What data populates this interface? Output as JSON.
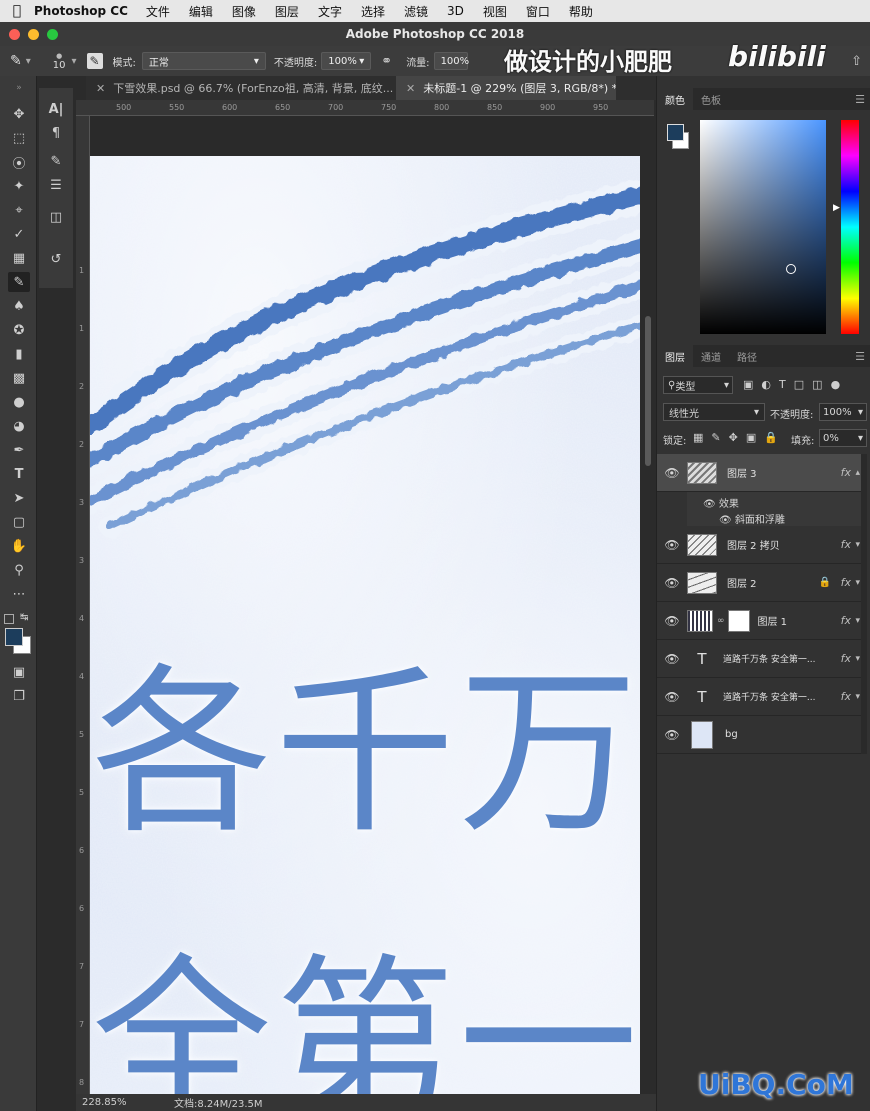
{
  "menubar": {
    "app_name": "Photoshop CC",
    "items": [
      "文件",
      "编辑",
      "图像",
      "图层",
      "文字",
      "选择",
      "滤镜",
      "3D",
      "视图",
      "窗口",
      "帮助"
    ]
  },
  "window": {
    "title": "Adobe Photoshop CC 2018"
  },
  "options": {
    "brush_size": "10",
    "mode_label": "模式:",
    "mode_value": "正常",
    "opacity_label": "不透明度:",
    "opacity_value": "100%",
    "flow_label": "流量:",
    "flow_value": "100%"
  },
  "watermark_top": "做设计的小肥肥",
  "watermark_logo": "bilibili",
  "tabs": [
    {
      "label": "下雪效果.psd @ 66.7% (ForEnzo祖, 高清, 背景, 底纹..."
    },
    {
      "label": "未标题-1 @ 229% (图层 3, RGB/8*) *"
    }
  ],
  "ruler_h": [
    "500",
    "550",
    "600",
    "650",
    "700",
    "750",
    "800",
    "850",
    "900",
    "950"
  ],
  "ruler_v": [
    "1",
    "1",
    "2",
    "2",
    "3",
    "3",
    "4",
    "4",
    "5",
    "5",
    "6",
    "6",
    "7",
    "7",
    "8",
    "8"
  ],
  "status": {
    "zoom": "228.85%",
    "doc": "文档:8.24M/23.5M"
  },
  "canvas_text": {
    "row1": [
      "各",
      "千",
      "万"
    ],
    "row2": [
      "全",
      "第",
      "一"
    ]
  },
  "color_panel": {
    "tabs": [
      "颜色",
      "色板"
    ],
    "foreground": "#1c3d5c",
    "background": "#ffffff"
  },
  "layers_panel": {
    "tabs": [
      "图层",
      "通道",
      "路径"
    ],
    "filter_label": "类型",
    "blend_mode": "线性光",
    "opacity_label": "不透明度:",
    "opacity_value": "100%",
    "lock_label": "锁定:",
    "fill_label": "填充:",
    "fill_value": "0%",
    "effects_label": "效果",
    "effect_name": "斜面和浮雕",
    "layers": [
      {
        "name": "图层 3",
        "fx": "fx"
      },
      {
        "name": "图层 2 拷贝",
        "fx": "fx"
      },
      {
        "name": "图层 2",
        "fx": "fx"
      },
      {
        "name": "图层 1",
        "fx": "fx"
      },
      {
        "name": "道路千万条 安全第一...",
        "fx": "fx"
      },
      {
        "name": "道路千万条 安全第一...",
        "fx": "fx"
      },
      {
        "name": "bg",
        "fx": ""
      }
    ]
  },
  "watermark_bottom": "UiBQ.CoM"
}
